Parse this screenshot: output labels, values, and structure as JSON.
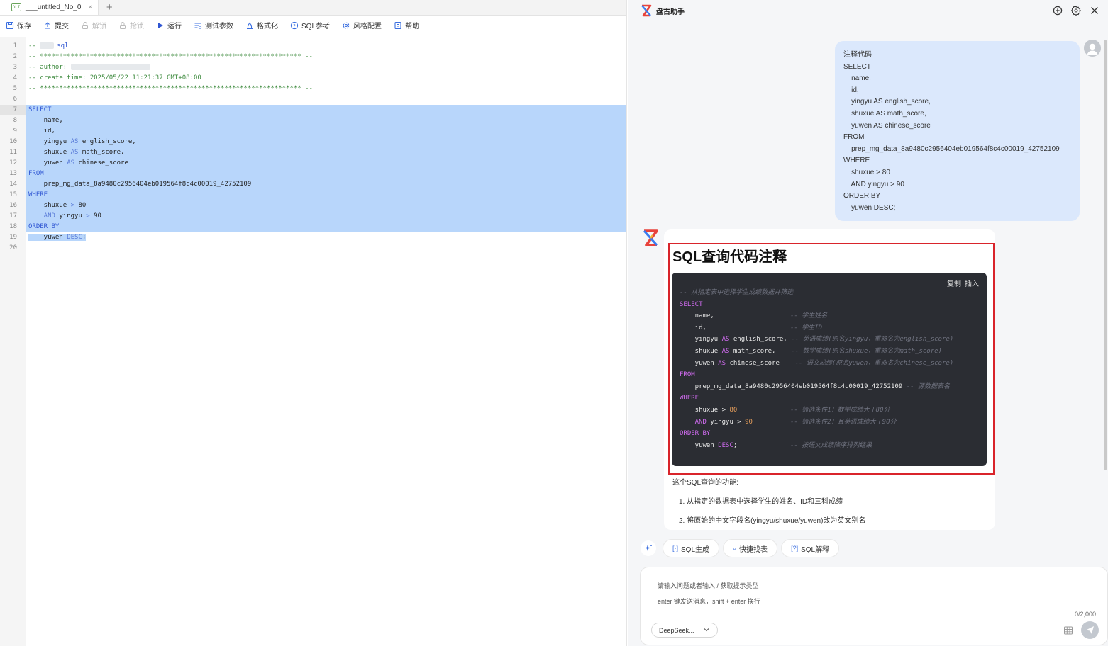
{
  "editor": {
    "tab": {
      "icon_text": "DLI",
      "title": "___untitled_No_0",
      "close": "×",
      "add": "+"
    },
    "toolbar": [
      {
        "icon": "save-icon",
        "label": "保存",
        "disabled": false
      },
      {
        "icon": "upload-icon",
        "label": "提交",
        "disabled": false
      },
      {
        "icon": "unlock-icon",
        "label": "解锁",
        "disabled": true
      },
      {
        "icon": "lock-icon",
        "label": "抢锁",
        "disabled": true
      },
      {
        "icon": "play-icon",
        "label": "运行",
        "disabled": false
      },
      {
        "icon": "params-icon",
        "label": "测试参数",
        "disabled": false
      },
      {
        "icon": "format-icon",
        "label": "格式化",
        "disabled": false
      },
      {
        "icon": "help-circle-icon",
        "label": "SQL参考",
        "disabled": false
      },
      {
        "icon": "gear-icon",
        "label": "风格配置",
        "disabled": false
      },
      {
        "icon": "book-icon",
        "label": "帮助",
        "disabled": false
      }
    ],
    "line_numbers": [
      "1",
      "2",
      "3",
      "4",
      "5",
      "6",
      "7",
      "8",
      "9",
      "10",
      "11",
      "12",
      "13",
      "14",
      "15",
      "16",
      "17",
      "18",
      "19",
      "20"
    ],
    "code": {
      "l1_prefix": "-- ",
      "l1_suffix": "sql",
      "l2": "-- ******************************************************************** --",
      "l3": "-- author:",
      "l4": "-- create time: 2025/05/22 11:21:37 GMT+08:00",
      "l5": "-- ******************************************************************** --",
      "l7": "SELECT",
      "l8": "    name,",
      "l9": "    id,",
      "l10_a": "    yingyu ",
      "l10_kw": "AS",
      "l10_b": " english_score,",
      "l11_a": "    shuxue ",
      "l11_kw": "AS",
      "l11_b": " math_score,",
      "l12_a": "    yuwen ",
      "l12_kw": "AS",
      "l12_b": " chinese_score",
      "l13": "FROM",
      "l14": "    prep_mg_data_8a9480c2956404eb019564f8c4c00019_42752109",
      "l15": "WHERE",
      "l16_a": "    shuxue ",
      "l16_op": ">",
      "l16_b": " 80",
      "l17_kw": "    AND",
      "l17_a": " yingyu ",
      "l17_op": ">",
      "l17_b": " 90",
      "l18": "ORDER BY",
      "l19_a": "    yuwen ",
      "l19_kw": "DESC",
      "l19_b": ";"
    }
  },
  "assistant": {
    "title": "盘古助手",
    "user_message": [
      "注释代码",
      "SELECT",
      "    name,",
      "    id,",
      "    yingyu AS english_score,",
      "    shuxue AS math_score,",
      "    yuwen AS chinese_score",
      "FROM",
      "    prep_mg_data_8a9480c2956404eb019564f8c4c00019_42752109",
      "WHERE",
      "    shuxue > 80",
      "    AND yingyu > 90",
      "ORDER BY",
      "    yuwen DESC;"
    ],
    "answer": {
      "title": "SQL查询代码注释",
      "copy": "复制",
      "insert": "插入",
      "code": {
        "c1": "-- 从指定表中选择学生成绩数据并筛选",
        "c2": "SELECT",
        "c3_a": "    name,",
        "c3_c": "-- 学生姓名",
        "c4_a": "    id,",
        "c4_c": "-- 学生ID",
        "c5_a": "    yingyu ",
        "c5_kw": "AS",
        "c5_b": " english_score,",
        "c5_c": "-- 英语成绩(原名yingyu，重命名为english_score)",
        "c6_a": "    shuxue ",
        "c6_kw": "AS",
        "c6_b": " math_score,",
        "c6_c": "-- 数学成绩(原名shuxue，重命名为math_score)",
        "c7_a": "    yuwen ",
        "c7_kw": "AS",
        "c7_b": " chinese_score",
        "c7_c": "-- 语文成绩(原名yuwen，重命名为chinese_score)",
        "c8": "FROM",
        "c9_a": "    prep_mg_data_8a9480c2956404eb019564f8c4c00019_42752109",
        "c9_c": "-- 源数据表名",
        "c10": "WHERE",
        "c11_a": "    shuxue > ",
        "c11_n": "80",
        "c11_c": "-- 筛选条件1：数学成绩大于80分",
        "c12_kw": "    AND",
        "c12_a": " yingyu > ",
        "c12_n": "90",
        "c12_c": "-- 筛选条件2：且英语成绩大于90分",
        "c13": "ORDER BY",
        "c14_a": "    yuwen ",
        "c14_kw": "DESC",
        "c14_b": ";",
        "c14_c": "-- 按语文成绩降序排列结果"
      },
      "summary": "这个SQL查询的功能:",
      "points": [
        "1. 从指定的数据表中选择学生的姓名、ID和三科成绩",
        "2. 将原始的中文字段名(yingyu/shuxue/yuwen)改为英文别名"
      ]
    },
    "quick_actions": [
      "SQL生成",
      "快捷找表",
      "SQL解释"
    ],
    "input": {
      "placeholder": "请输入问题或者输入 / 获取提示类型",
      "hint": "enter 键发送消息，shift + enter 换行",
      "count": "0/2,000",
      "model": "DeepSeek..."
    }
  }
}
